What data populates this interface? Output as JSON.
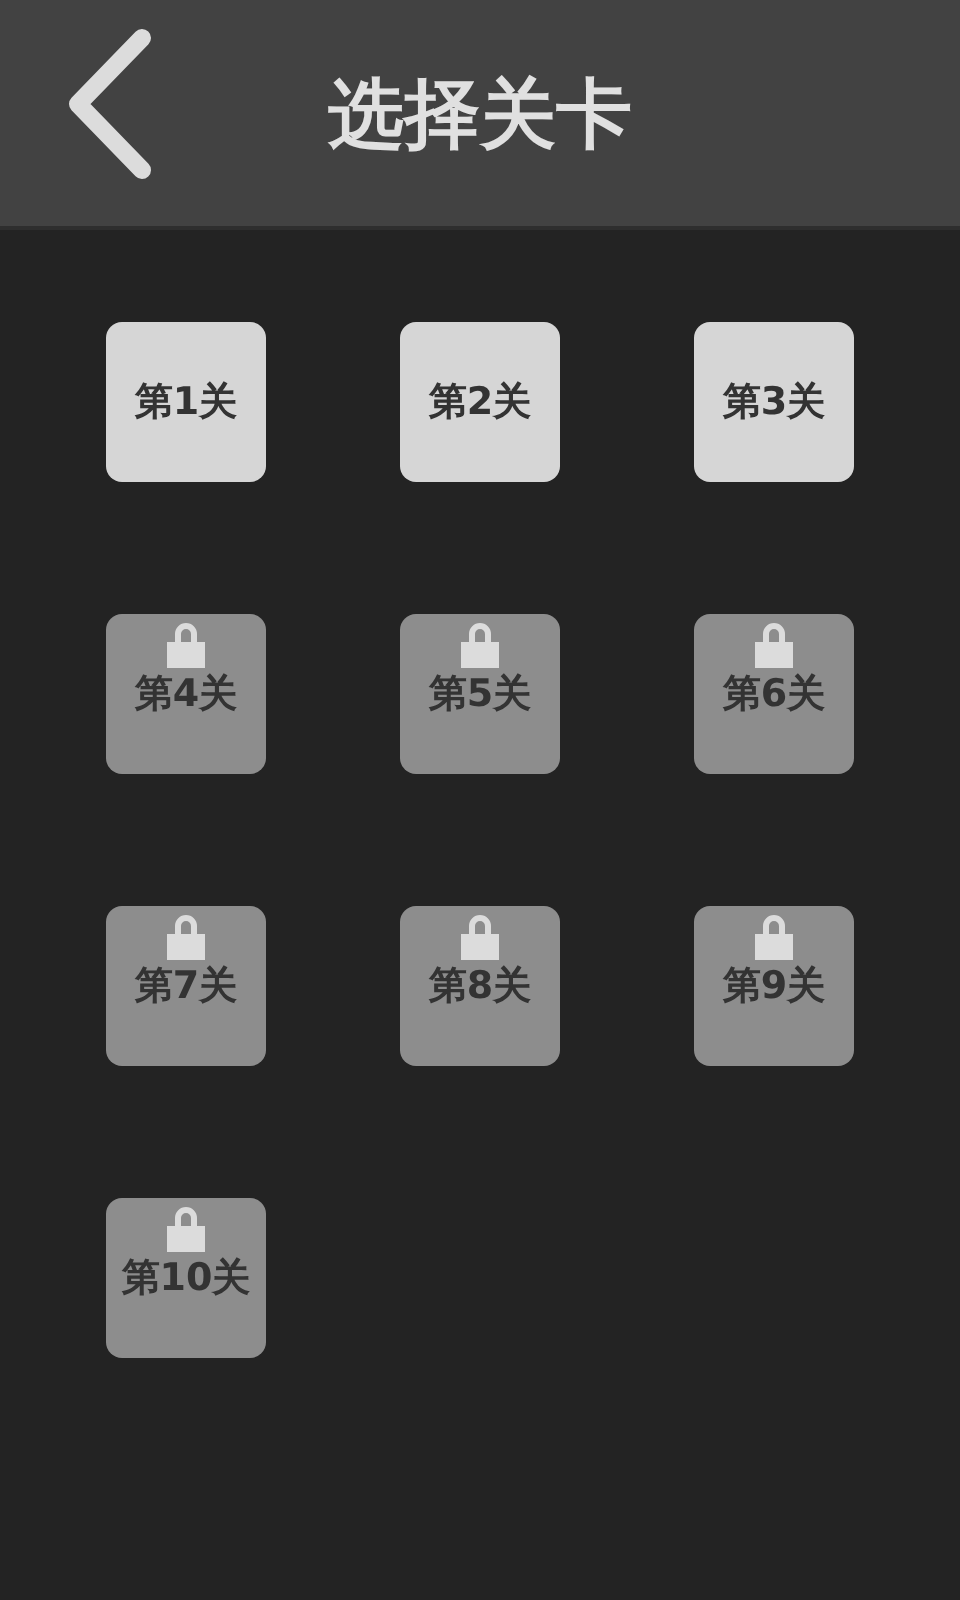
{
  "header": {
    "title": "选择关卡"
  },
  "levels": [
    {
      "label": "第1关",
      "locked": false
    },
    {
      "label": "第2关",
      "locked": false
    },
    {
      "label": "第3关",
      "locked": false
    },
    {
      "label": "第4关",
      "locked": true
    },
    {
      "label": "第5关",
      "locked": true
    },
    {
      "label": "第6关",
      "locked": true
    },
    {
      "label": "第7关",
      "locked": true
    },
    {
      "label": "第8关",
      "locked": true
    },
    {
      "label": "第9关",
      "locked": true
    },
    {
      "label": "第10关",
      "locked": true
    }
  ]
}
